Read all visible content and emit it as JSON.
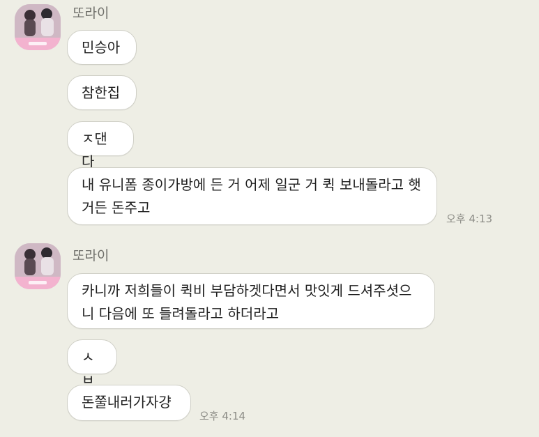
{
  "groups": [
    {
      "sender": "또라이",
      "messages": [
        "민승아",
        "참한집",
        "ㅈ댄다",
        "내 유니폼 종이가방에 든 거 어제 일군 거 퀵 보내돌라고 햇\n거든 돈주고"
      ],
      "time": "오후 4:13"
    },
    {
      "sender": "또라이",
      "messages": [
        "카니까 저희들이 퀵비 부담하겟다면서 맛잇게 드셔주셧으\n니 다음에 또 들려돌라고 하더라고",
        "ㅅㅂ",
        "돈쭐내러가자걍"
      ],
      "time": "오후 4:14"
    }
  ],
  "colors": {
    "background": "#eeeee5",
    "bubble": "#ffffff",
    "bubble_border": "#cfcfc6",
    "sender_text": "#6f6f6a",
    "time_text": "#8c8c86"
  },
  "icons": {
    "avatar": "profile-photo-avatar"
  }
}
